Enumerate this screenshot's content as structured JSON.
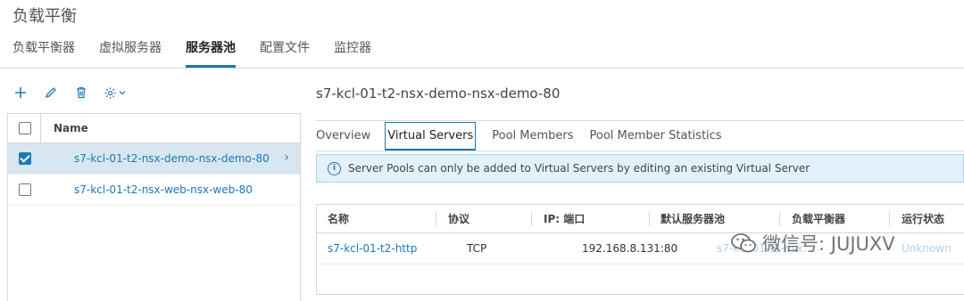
{
  "app": {
    "title": "负载平衡"
  },
  "tabs": [
    {
      "label": "负载平衡器"
    },
    {
      "label": "虚拟服务器"
    },
    {
      "label": "服务器池"
    },
    {
      "label": "配置文件"
    },
    {
      "label": "监控器"
    }
  ],
  "toolbar": {
    "add_icon": "plus-icon",
    "edit_icon": "pencil-icon",
    "delete_icon": "trash-icon",
    "settings_icon": "gear-icon"
  },
  "list": {
    "header": "Name",
    "rows": [
      {
        "label": "s7-kcl-01-t2-nsx-demo-nsx-demo-80",
        "selected": true
      },
      {
        "label": "s7-kcl-01-t2-nsx-web-nsx-web-80",
        "selected": false
      }
    ]
  },
  "detail": {
    "title": "s7-kcl-01-t2-nsx-demo-nsx-demo-80",
    "subtabs": [
      {
        "label": "Overview"
      },
      {
        "label": "Virtual Servers"
      },
      {
        "label": "Pool Members"
      },
      {
        "label": "Pool Member Statistics"
      }
    ],
    "info": "Server Pools can only be added to Virtual Servers by editing an existing Virtual Server",
    "grid": {
      "headers": [
        "名称",
        "协议",
        "IP: 端口",
        "默认服务器池",
        "负载平衡器",
        "运行状态"
      ],
      "rows": [
        [
          "s7-kcl-01-t2-http",
          "TCP",
          "192.168.8.131:80",
          "s7-kcl-01-t2-nsx...",
          "",
          "Unknown"
        ]
      ]
    }
  },
  "watermark": {
    "text": "微信号: JUJUXV"
  },
  "colors": {
    "accent": "#1b79b6",
    "selected_row": "#d7e6f1",
    "info_bg": "#e2f1fb"
  }
}
